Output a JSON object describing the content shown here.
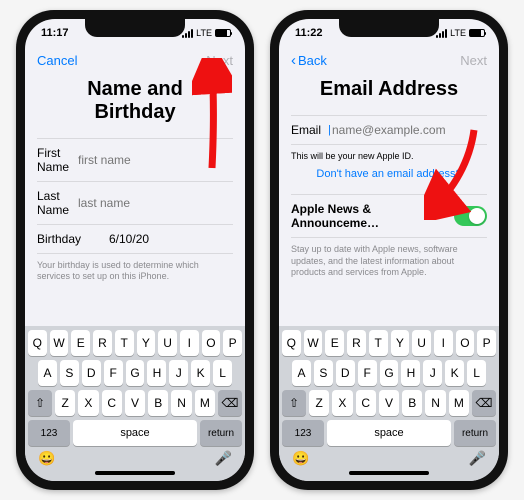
{
  "left": {
    "time": "11:17",
    "lte": "LTE",
    "cancel": "Cancel",
    "next": "Next",
    "title_l1": "Name and",
    "title_l2": "Birthday",
    "rows": {
      "first_label": "First Name",
      "first_ph": "first name",
      "last_label": "Last Name",
      "last_ph": "last name",
      "bday_label": "Birthday",
      "bday_val": "6/10/20"
    },
    "fine": "Your birthday is used to determine which services to set up on this iPhone."
  },
  "right": {
    "time": "11:22",
    "lte": "LTE",
    "back": "Back",
    "next": "Next",
    "title": "Email Address",
    "email_label": "Email",
    "email_ph": "name@example.com",
    "note": "This will be your new Apple ID.",
    "link": "Don't have an email address?",
    "toggle_label": "Apple News & Announceme…",
    "desc": "Stay up to date with Apple news, software updates, and the latest information about products and services from Apple."
  },
  "kb": {
    "r1": [
      "Q",
      "W",
      "E",
      "R",
      "T",
      "Y",
      "U",
      "I",
      "O",
      "P"
    ],
    "r2": [
      "A",
      "S",
      "D",
      "F",
      "G",
      "H",
      "J",
      "K",
      "L"
    ],
    "r3": [
      "Z",
      "X",
      "C",
      "V",
      "B",
      "N",
      "M"
    ],
    "shift": "⇧",
    "bksp": "⌫",
    "num": "123",
    "space": "space",
    "ret": "return",
    "emoji": "😀",
    "mic": "🎤"
  }
}
